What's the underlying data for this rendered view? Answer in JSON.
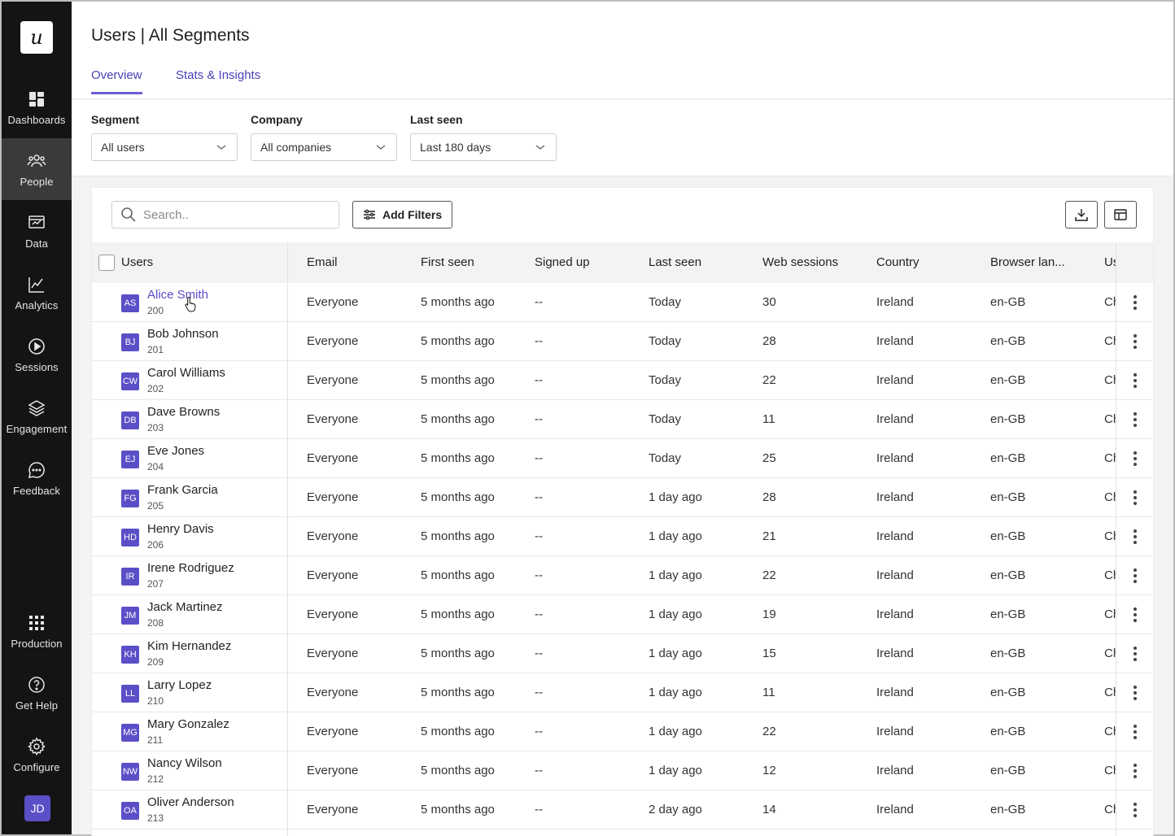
{
  "sidebar": {
    "logo_letter": "u",
    "items": [
      {
        "label": "Dashboards",
        "icon": "dashboard-icon"
      },
      {
        "label": "People",
        "icon": "people-icon",
        "active": true
      },
      {
        "label": "Data",
        "icon": "data-icon"
      },
      {
        "label": "Analytics",
        "icon": "analytics-icon"
      },
      {
        "label": "Sessions",
        "icon": "sessions-icon"
      },
      {
        "label": "Engagement",
        "icon": "engagement-icon"
      },
      {
        "label": "Feedback",
        "icon": "feedback-icon"
      }
    ],
    "bottom_items": [
      {
        "label": "Production",
        "icon": "grid-icon"
      },
      {
        "label": "Get Help",
        "icon": "help-icon"
      },
      {
        "label": "Configure",
        "icon": "gear-icon"
      }
    ],
    "user_initials": "JD"
  },
  "header": {
    "title": "Users | All Segments",
    "tabs": [
      {
        "label": "Overview",
        "active": true
      },
      {
        "label": "Stats & Insights",
        "active": false
      }
    ]
  },
  "filters": [
    {
      "label": "Segment",
      "value": "All users"
    },
    {
      "label": "Company",
      "value": "All companies"
    },
    {
      "label": "Last seen",
      "value": "Last 180 days"
    }
  ],
  "toolbar": {
    "search_placeholder": "Search..",
    "add_filters_label": "Add Filters",
    "download_icon": "download-icon",
    "columns_icon": "table-columns-icon"
  },
  "table": {
    "columns": [
      "Users",
      "Email",
      "First seen",
      "Signed up",
      "Last seen",
      "Web sessions",
      "Country",
      "Browser lan...",
      "Us"
    ],
    "rows": [
      {
        "initials": "AS",
        "name": "Alice Smith",
        "id": "200",
        "email": "Everyone",
        "first_seen": "5 months ago",
        "signed_up": "--",
        "last_seen": "Today",
        "web_sessions": "30",
        "country": "Ireland",
        "browser_lang": "en-GB",
        "extra": "Ch"
      },
      {
        "initials": "BJ",
        "name": "Bob Johnson",
        "id": "201",
        "email": "Everyone",
        "first_seen": "5 months ago",
        "signed_up": "--",
        "last_seen": "Today",
        "web_sessions": "28",
        "country": "Ireland",
        "browser_lang": "en-GB",
        "extra": "Ch"
      },
      {
        "initials": "CW",
        "name": "Carol Williams",
        "id": "202",
        "email": "Everyone",
        "first_seen": "5 months ago",
        "signed_up": "--",
        "last_seen": "Today",
        "web_sessions": "22",
        "country": "Ireland",
        "browser_lang": "en-GB",
        "extra": "Ch"
      },
      {
        "initials": "DB",
        "name": "Dave Browns",
        "id": "203",
        "email": "Everyone",
        "first_seen": "5 months ago",
        "signed_up": "--",
        "last_seen": "Today",
        "web_sessions": "11",
        "country": "Ireland",
        "browser_lang": "en-GB",
        "extra": "Ch"
      },
      {
        "initials": "EJ",
        "name": "Eve Jones",
        "id": "204",
        "email": "Everyone",
        "first_seen": "5 months ago",
        "signed_up": "--",
        "last_seen": "Today",
        "web_sessions": "25",
        "country": "Ireland",
        "browser_lang": "en-GB",
        "extra": "Ch"
      },
      {
        "initials": "FG",
        "name": "Frank Garcia",
        "id": "205",
        "email": "Everyone",
        "first_seen": "5 months ago",
        "signed_up": "--",
        "last_seen": "1 day ago",
        "web_sessions": "28",
        "country": "Ireland",
        "browser_lang": "en-GB",
        "extra": "Ch"
      },
      {
        "initials": "HD",
        "name": "Henry Davis",
        "id": "206",
        "email": "Everyone",
        "first_seen": "5 months ago",
        "signed_up": "--",
        "last_seen": "1 day ago",
        "web_sessions": "21",
        "country": "Ireland",
        "browser_lang": "en-GB",
        "extra": "Ch"
      },
      {
        "initials": "IR",
        "name": "Irene Rodriguez",
        "id": "207",
        "email": "Everyone",
        "first_seen": "5 months ago",
        "signed_up": "--",
        "last_seen": "1 day ago",
        "web_sessions": "22",
        "country": "Ireland",
        "browser_lang": "en-GB",
        "extra": "Ch"
      },
      {
        "initials": "JM",
        "name": "Jack Martinez",
        "id": "208",
        "email": "Everyone",
        "first_seen": "5 months ago",
        "signed_up": "--",
        "last_seen": "1 day ago",
        "web_sessions": "19",
        "country": "Ireland",
        "browser_lang": "en-GB",
        "extra": "Ch"
      },
      {
        "initials": "KH",
        "name": "Kim Hernandez",
        "id": "209",
        "email": "Everyone",
        "first_seen": "5 months ago",
        "signed_up": "--",
        "last_seen": "1 day ago",
        "web_sessions": "15",
        "country": "Ireland",
        "browser_lang": "en-GB",
        "extra": "Ch"
      },
      {
        "initials": "LL",
        "name": "Larry Lopez",
        "id": "210",
        "email": "Everyone",
        "first_seen": "5 months ago",
        "signed_up": "--",
        "last_seen": "1 day ago",
        "web_sessions": "11",
        "country": "Ireland",
        "browser_lang": "en-GB",
        "extra": "Ch"
      },
      {
        "initials": "MG",
        "name": "Mary Gonzalez",
        "id": "211",
        "email": "Everyone",
        "first_seen": "5 months ago",
        "signed_up": "--",
        "last_seen": "1 day ago",
        "web_sessions": "22",
        "country": "Ireland",
        "browser_lang": "en-GB",
        "extra": "Ch"
      },
      {
        "initials": "NW",
        "name": "Nancy Wilson",
        "id": "212",
        "email": "Everyone",
        "first_seen": "5 months ago",
        "signed_up": "--",
        "last_seen": "1 day ago",
        "web_sessions": "12",
        "country": "Ireland",
        "browser_lang": "en-GB",
        "extra": "Ch"
      },
      {
        "initials": "OA",
        "name": "Oliver Anderson",
        "id": "213",
        "email": "Everyone",
        "first_seen": "5 months ago",
        "signed_up": "--",
        "last_seen": "2 day ago",
        "web_sessions": "14",
        "country": "Ireland",
        "browser_lang": "en-GB",
        "extra": "Ch"
      }
    ]
  },
  "colors": {
    "sidebar_bg": "#141414",
    "sidebar_active": "#3a3a3c",
    "accent": "#5b4fc7",
    "tab_underline": "#6a5fd3",
    "header_row_bg": "#f3f3f4"
  }
}
